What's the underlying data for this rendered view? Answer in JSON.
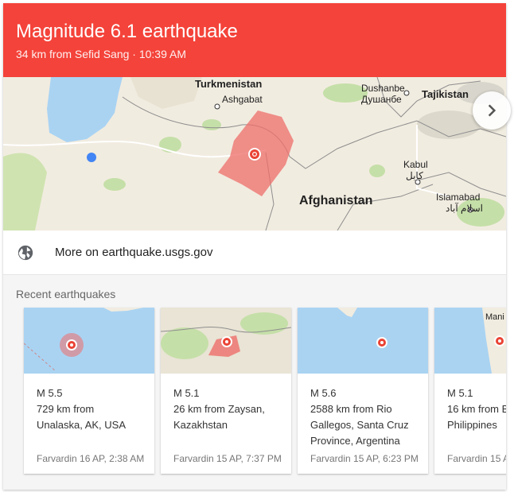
{
  "header": {
    "title": "Magnitude 6.1 earthquake",
    "subtitle": "34 km from Sefid Sang · 10:39 AM",
    "bg_color": "#f4433a"
  },
  "map": {
    "labels": {
      "turkmenistan": "Turkmenistan",
      "ashgabat": "Ashgabat",
      "dushanbe": "Dushanbe",
      "dushanbe_local": "Душанбе",
      "tajikistan": "Tajikistan",
      "kabul": "Kabul",
      "kabul_local": "کابل",
      "afghanistan": "Afghanistan",
      "islamabad": "Islamabad",
      "islamabad_local": "اسلام آباد"
    }
  },
  "link": {
    "icon": "globe-icon",
    "label": "More on earthquake.usgs.gov"
  },
  "recent": {
    "title": "Recent earthquakes",
    "items": [
      {
        "magnitude": "M 5.5",
        "location": "729 km from Unalaska, AK, USA",
        "date": "Farvardin 16 AP, 2:38 AM"
      },
      {
        "magnitude": "M 5.1",
        "location": "26 km from Zaysan, Kazakhstan",
        "date": "Farvardin 15 AP, 7:37 PM"
      },
      {
        "magnitude": "M 5.6",
        "location": "2588 km from Rio Gallegos, Santa Cruz Province, Argentina",
        "date": "Farvardin 15 AP, 6:23 PM"
      },
      {
        "magnitude": "M 5.1",
        "location": "16 km from B... Philippines",
        "date": "Farvardin 15 A",
        "map_label": "Mani"
      }
    ],
    "next_icon": "chevron-right-icon"
  }
}
